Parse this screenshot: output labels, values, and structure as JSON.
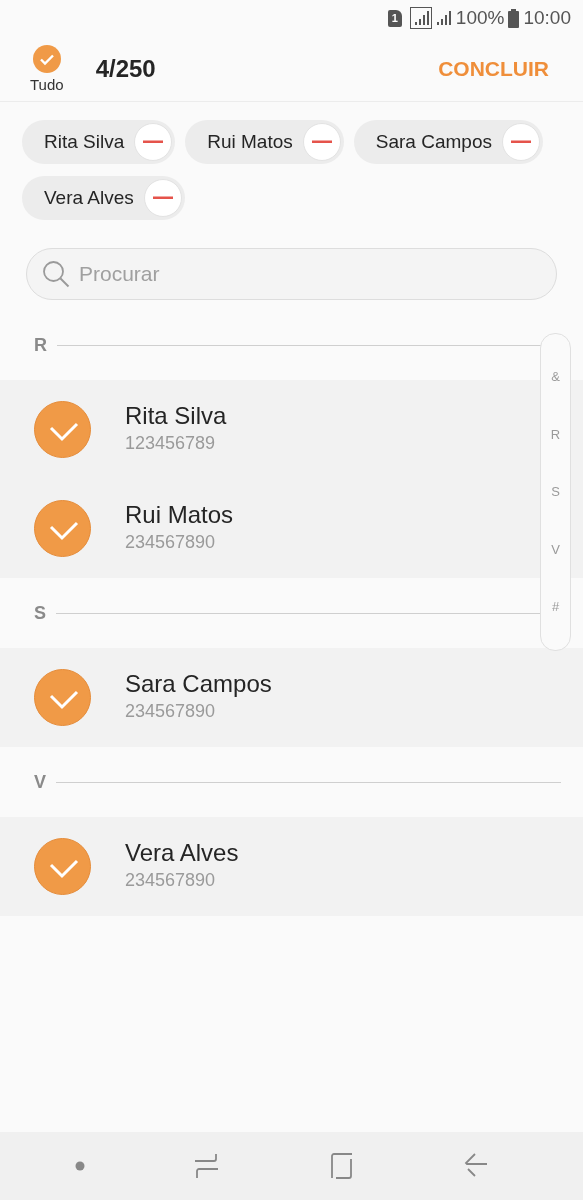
{
  "status_bar": {
    "sim": "1",
    "battery": "100%",
    "time": "10:00"
  },
  "header": {
    "select_all": {
      "label": "Tudo",
      "checked": true
    },
    "count": "4/250",
    "done": "CONCLUIR"
  },
  "chips": [
    {
      "label": "Rita Silva"
    },
    {
      "label": "Rui Matos"
    },
    {
      "label": "Sara Campos"
    },
    {
      "label": "Vera Alves"
    }
  ],
  "search": {
    "placeholder": "Procurar"
  },
  "sections": [
    {
      "letter": "R",
      "contacts": [
        {
          "name": "Rita Silva",
          "number": "123456789",
          "selected": true
        },
        {
          "name": "Rui Matos",
          "number": "234567890",
          "selected": true
        }
      ]
    },
    {
      "letter": "S",
      "contacts": [
        {
          "name": "Sara Campos",
          "number": "234567890",
          "selected": true
        }
      ]
    },
    {
      "letter": "V",
      "contacts": [
        {
          "name": "Vera Alves",
          "number": "234567890",
          "selected": true
        }
      ]
    }
  ],
  "index_scroller": [
    "&",
    "R",
    "S",
    "V",
    "#"
  ]
}
